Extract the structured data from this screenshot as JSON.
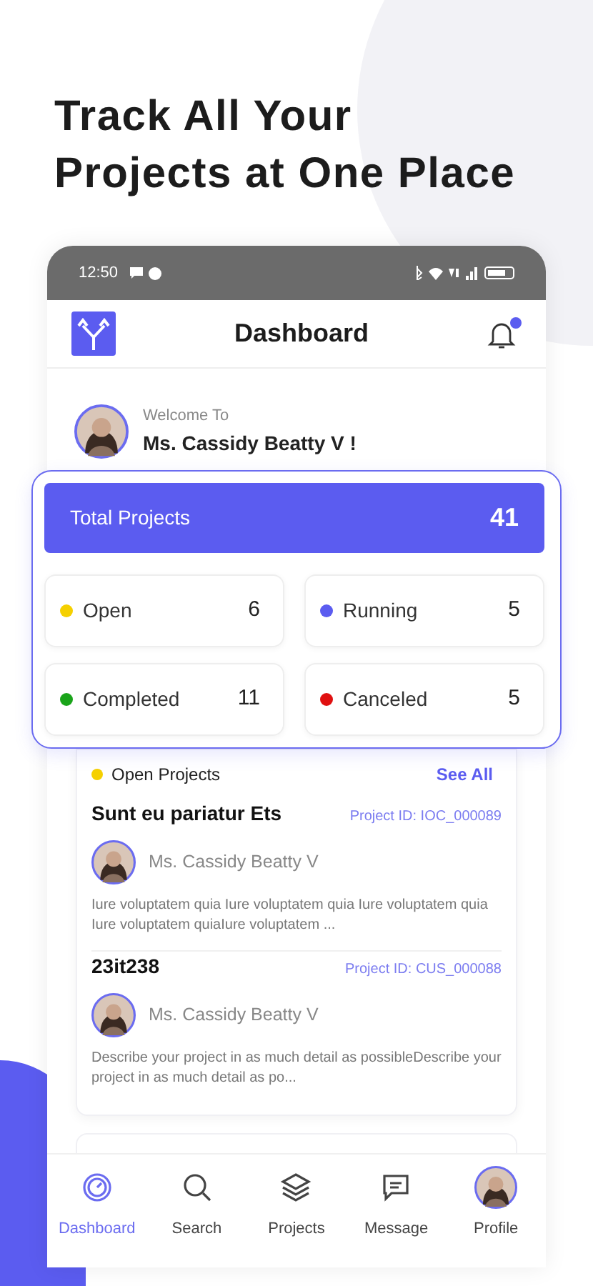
{
  "headline": "Track All Your Projects at One Place",
  "status_bar": {
    "time": "12:50"
  },
  "header": {
    "title": "Dashboard",
    "notification_dot": true
  },
  "welcome": {
    "greeting": "Welcome To",
    "name": "Ms. Cassidy Beatty V !"
  },
  "total": {
    "label": "Total Projects",
    "count": "41"
  },
  "stats": [
    {
      "label": "Open",
      "count": "6",
      "color": "#f5d000"
    },
    {
      "label": "Running",
      "count": "5",
      "color": "#5b5cf0"
    },
    {
      "label": "Completed",
      "count": "11",
      "color": "#1aa41a"
    },
    {
      "label": "Canceled",
      "count": "5",
      "color": "#e01010"
    }
  ],
  "open_projects": {
    "title": "Open Projects",
    "color": "#f5d000",
    "link": "See All",
    "items": [
      {
        "title": "Sunt eu pariatur Ets",
        "project_id": "Project ID: IOC_000089",
        "owner": "Ms. Cassidy Beatty V",
        "description": "Iure voluptatem quia Iure voluptatem quia  Iure voluptatem quia Iure voluptatem quiaIure voluptatem ..."
      },
      {
        "title": "23it238",
        "project_id": "Project ID: CUS_000088",
        "owner": "Ms. Cassidy Beatty V",
        "description": "Describe your project in as much detail as possibleDescribe your project in as much detail as po..."
      }
    ]
  },
  "nav": [
    {
      "kind": "dashboard",
      "label": "Dashboard",
      "selected": true
    },
    {
      "kind": "search",
      "label": "Search",
      "selected": false
    },
    {
      "kind": "projects",
      "label": "Projects",
      "selected": false
    },
    {
      "kind": "message",
      "label": "Message",
      "selected": false
    },
    {
      "kind": "profile",
      "label": "Profile",
      "selected": false
    }
  ]
}
